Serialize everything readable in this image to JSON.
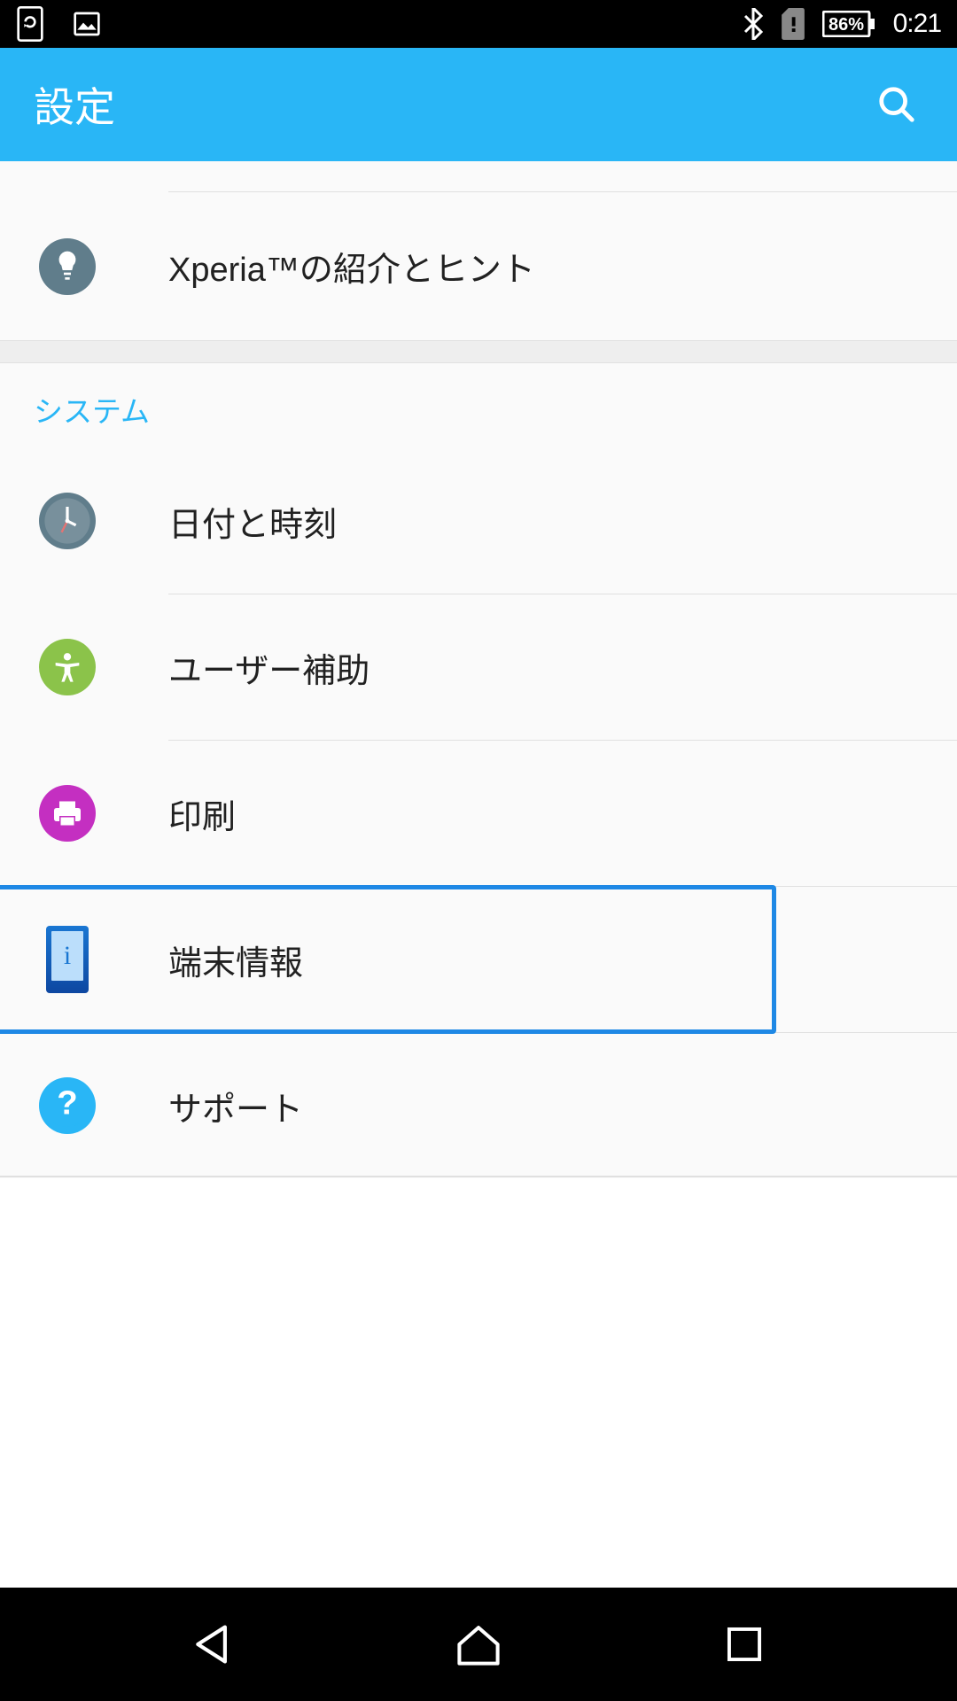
{
  "status": {
    "battery_percent": "86%",
    "time": "0:21"
  },
  "appbar": {
    "title": "設定"
  },
  "items": {
    "xperia_tips": "Xperia™の紹介とヒント",
    "section_system": "システム",
    "date_time": "日付と時刻",
    "accessibility": "ユーザー補助",
    "printing": "印刷",
    "about_phone": "端末情報",
    "support": "サポート"
  }
}
